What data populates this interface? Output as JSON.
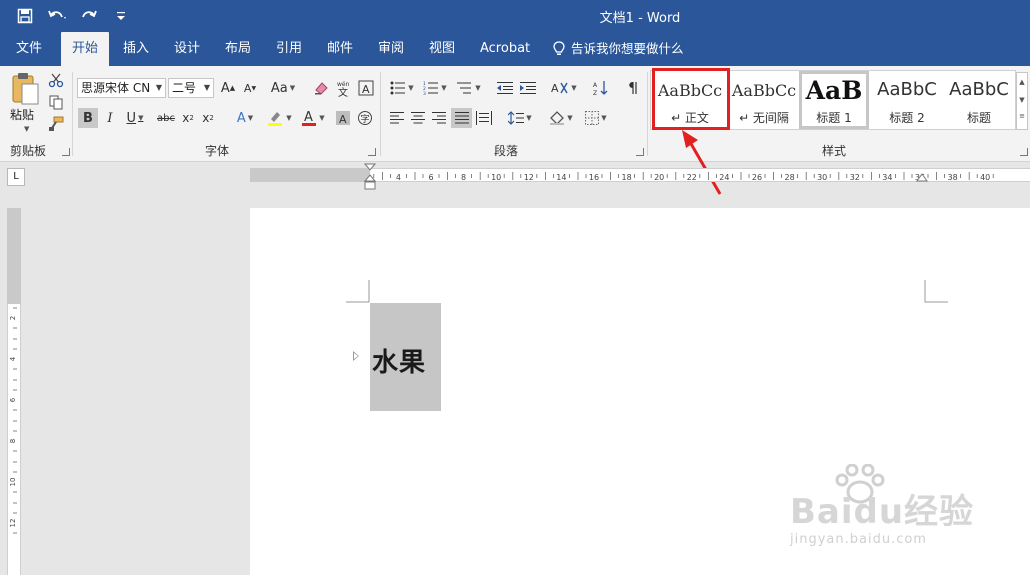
{
  "window": {
    "title": "文档1  -  Word"
  },
  "quick_access": {
    "icons": [
      "save-icon",
      "undo-icon",
      "redo-icon",
      "customize-icon"
    ]
  },
  "tabs": [
    {
      "label": "文件"
    },
    {
      "label": "开始",
      "active": true
    },
    {
      "label": "插入"
    },
    {
      "label": "设计"
    },
    {
      "label": "布局"
    },
    {
      "label": "引用"
    },
    {
      "label": "邮件"
    },
    {
      "label": "审阅"
    },
    {
      "label": "视图"
    },
    {
      "label": "Acrobat"
    }
  ],
  "tell_me": "告诉我你想要做什么",
  "ribbon": {
    "clipboard": {
      "paste_label": "粘贴",
      "group_label": "剪贴板"
    },
    "font": {
      "font_name": "思源宋体 CN",
      "font_size": "二号",
      "group_label": "字体",
      "font_color": "#e2201f",
      "highlight_color": "#ffff00"
    },
    "paragraph": {
      "group_label": "段落"
    },
    "styles": {
      "group_label": "样式",
      "items": [
        {
          "sample": "AaBbCc",
          "name": "↵ 正文"
        },
        {
          "sample": "AaBbCc",
          "name": "↵ 无间隔"
        },
        {
          "sample": "AaB",
          "name": "标题 1"
        },
        {
          "sample": "AaBbC",
          "name": "标题 2"
        },
        {
          "sample": "AaBbC",
          "name": "标题"
        }
      ]
    }
  },
  "ruler": {
    "labels": [
      "6",
      "4",
      "2",
      "2",
      "4",
      "6",
      "8",
      "10",
      "12",
      "14",
      "16",
      "18",
      "20",
      "22",
      "24",
      "26",
      "28",
      "30",
      "32",
      "34",
      "36",
      "38",
      "40"
    ],
    "vlabels": [
      "4",
      "2",
      "2",
      "4",
      "6",
      "8",
      "10",
      "12"
    ]
  },
  "document": {
    "heading": "水果"
  },
  "watermark": {
    "brand": "Baidu经验",
    "url": "jingyan.baidu.com"
  },
  "colors": {
    "accent": "#2b579a",
    "highlight_box": "#e2201f"
  }
}
